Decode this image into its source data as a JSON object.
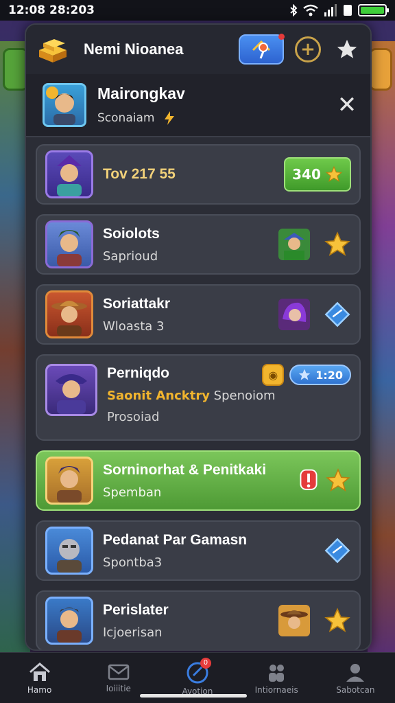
{
  "status_bar": {
    "time": "12:08 28:203"
  },
  "header": {
    "title": "Nemi Nioanea"
  },
  "profile": {
    "name": "Mairongkav",
    "subtitle": "Sconaiam"
  },
  "rows": [
    {
      "title": "Tov 217 55",
      "level": "340"
    },
    {
      "title": "Soiolots",
      "subtitle": "Saprioud"
    },
    {
      "title": "Soriattakr",
      "subtitle": "Wloasta 3"
    },
    {
      "title": "Perniqdo",
      "subtitle_gold": "Saonit Ancktry",
      "subtitle_rest": "Spenoiom",
      "subtitle2": "Prosoiad",
      "score": "1:20"
    },
    {
      "title": "Sorninorhat & Penitkaki",
      "subtitle": "Spemban"
    },
    {
      "title": "Pedanat Par Gamasn",
      "subtitle": "Spontba3"
    },
    {
      "title": "Perislater",
      "subtitle": "Icjoerisan"
    }
  ],
  "nav": [
    {
      "label": "Hamo",
      "icon": "home-icon"
    },
    {
      "label": "Ioiiitie",
      "icon": "mail-icon"
    },
    {
      "label": "Ayotion",
      "icon": "target-icon",
      "badge": "0"
    },
    {
      "label": "Intiornaeis",
      "icon": "people-icon"
    },
    {
      "label": "Sabotcan",
      "icon": "profile-icon"
    }
  ],
  "colors": {
    "accent_green": "#5aaf3e",
    "accent_blue": "#3a7de0",
    "gold": "#f2b52e",
    "panel": "#2b2d36"
  }
}
